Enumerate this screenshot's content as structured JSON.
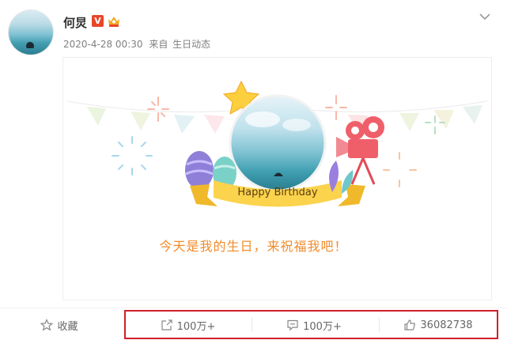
{
  "post": {
    "author": {
      "name": "何炅",
      "verified_badge": "V"
    },
    "meta": {
      "timestamp": "2020-4-28 00:30",
      "source_prefix": "来自",
      "source": "生日动态"
    },
    "card": {
      "banner_label": "Happy Birthday",
      "message": "今天是我的生日，来祝福我吧！"
    },
    "actions": {
      "favorite": "收藏",
      "share": "100万+",
      "comment": "100万+",
      "like": "36082738"
    }
  },
  "colors": {
    "badge_red": "#e8462b",
    "message_orange": "#f28b2c",
    "highlight_red": "#d01f2a",
    "muted_text": "#808080"
  },
  "icons": {
    "menu": "chevron-down-icon",
    "favorite": "star-outline-icon",
    "share": "share-arrow-icon",
    "comment": "comment-bubble-icon",
    "like": "thumbs-up-icon"
  }
}
